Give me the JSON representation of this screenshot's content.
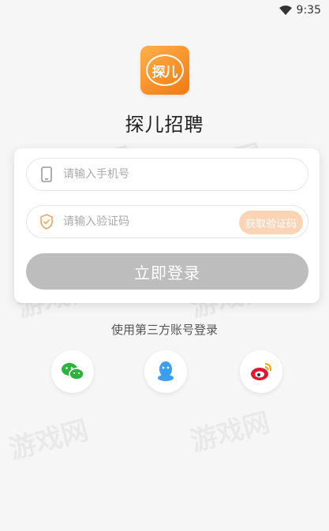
{
  "status_bar": {
    "time": "9:35"
  },
  "app": {
    "logo_text": "探儿",
    "name": "探儿招聘"
  },
  "login_form": {
    "phone_placeholder": "请输入手机号",
    "code_placeholder": "请输入验证码",
    "get_code_label": "获取验证码",
    "login_label": "立即登录"
  },
  "third_party": {
    "label": "使用第三方账号登录",
    "providers": [
      "wechat",
      "qq",
      "weibo"
    ]
  },
  "watermark": "游戏网",
  "colors": {
    "accent": "#f28a1e",
    "code_button": "#fbd4b6",
    "login_button": "#bdbdbd",
    "wechat": "#2bb33c",
    "qq": "#3a9ff0",
    "weibo": "#e6162d"
  }
}
